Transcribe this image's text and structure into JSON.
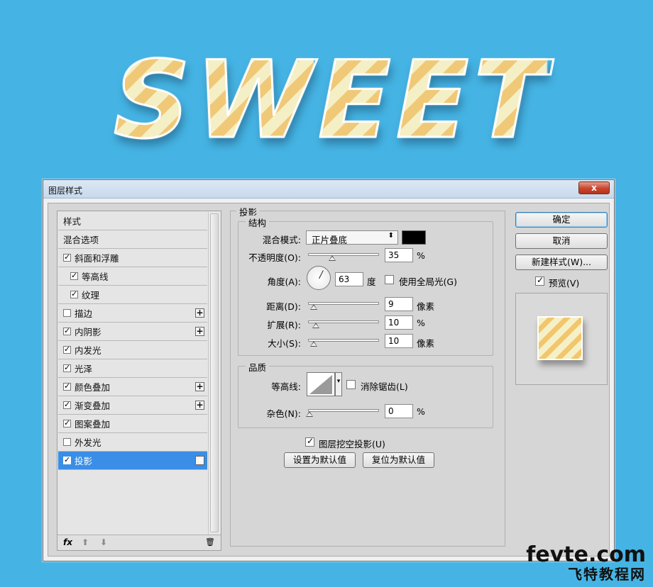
{
  "hero": {
    "text_letters": [
      "S",
      "W",
      "E",
      "E",
      "T"
    ]
  },
  "dialog": {
    "title": "图层样式",
    "close_label": "x",
    "style_list": {
      "rows": [
        {
          "label": "样式",
          "type": "header"
        },
        {
          "label": "混合选项",
          "type": "header"
        },
        {
          "label": "斜面和浮雕",
          "checked": true,
          "plus": false,
          "indent": false
        },
        {
          "label": "等高线",
          "checked": true,
          "plus": false,
          "indent": true
        },
        {
          "label": "纹理",
          "checked": true,
          "plus": false,
          "indent": true
        },
        {
          "label": "描边",
          "checked": false,
          "plus": true,
          "indent": false
        },
        {
          "label": "内阴影",
          "checked": true,
          "plus": true,
          "indent": false
        },
        {
          "label": "内发光",
          "checked": true,
          "plus": false,
          "indent": false
        },
        {
          "label": "光泽",
          "checked": true,
          "plus": false,
          "indent": false
        },
        {
          "label": "颜色叠加",
          "checked": true,
          "plus": true,
          "indent": false
        },
        {
          "label": "渐变叠加",
          "checked": true,
          "plus": true,
          "indent": false
        },
        {
          "label": "图案叠加",
          "checked": true,
          "plus": false,
          "indent": false
        },
        {
          "label": "外发光",
          "checked": false,
          "plus": false,
          "indent": false
        },
        {
          "label": "投影",
          "checked": true,
          "plus": true,
          "indent": false,
          "selected": true
        }
      ],
      "footer": {
        "fx": "fx",
        "up": "⬆",
        "down": "⬇",
        "trash": "🗑"
      }
    },
    "drop_shadow": {
      "section_title": "投影",
      "structure": {
        "title": "结构",
        "blend_mode_label": "混合模式:",
        "blend_mode_value": "正片叠底",
        "swatch_color": "#000000",
        "opacity_label": "不透明度(O):",
        "opacity_value": "35",
        "opacity_unit": "%",
        "angle_label": "角度(A):",
        "angle_value": "63",
        "angle_unit": "度",
        "global_light_label": "使用全局光(G)",
        "global_light_checked": false,
        "distance_label": "距离(D):",
        "distance_value": "9",
        "distance_unit": "像素",
        "spread_label": "扩展(R):",
        "spread_value": "10",
        "spread_unit": "%",
        "size_label": "大小(S):",
        "size_value": "10",
        "size_unit": "像素"
      },
      "quality": {
        "title": "品质",
        "contour_label": "等高线:",
        "antialias_label": "消除锯齿(L)",
        "antialias_checked": false,
        "noise_label": "杂色(N):",
        "noise_value": "0",
        "noise_unit": "%"
      },
      "knockout_label": "图层挖空投影(U)",
      "knockout_checked": true,
      "make_default": "设置为默认值",
      "reset_default": "复位为默认值"
    },
    "buttons": {
      "ok": "确定",
      "cancel": "取消",
      "new_style": "新建样式(W)...",
      "preview_label": "预览(V)",
      "preview_checked": true
    }
  },
  "watermark": {
    "line1": "fevte.com",
    "line2": "飞特教程网"
  }
}
